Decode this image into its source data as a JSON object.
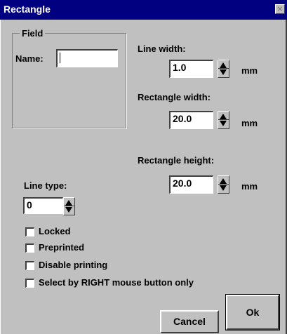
{
  "window": {
    "title": "Rectangle",
    "close_glyph": "×"
  },
  "field_group": {
    "legend": "Field",
    "name_label": "Name:",
    "name_value": ""
  },
  "line_width": {
    "label": "Line width:",
    "value": "1.0",
    "unit": "mm"
  },
  "rect_width": {
    "label": "Rectangle width:",
    "value": "20.0",
    "unit": "mm"
  },
  "rect_height": {
    "label": "Rectangle height:",
    "value": "20.0",
    "unit": "mm"
  },
  "line_type": {
    "label": "Line type:",
    "value": "0"
  },
  "options": [
    {
      "label": "Locked",
      "checked": false
    },
    {
      "label": "Preprinted",
      "checked": false
    },
    {
      "label": "Disable printing",
      "checked": false
    },
    {
      "label": "Select by RIGHT mouse button only",
      "checked": false
    }
  ],
  "buttons": {
    "cancel": "Cancel",
    "ok": "Ok"
  },
  "colors": {
    "title_bar": "#000080",
    "dialog_bg": "#c0c0c0",
    "field_bg": "#ffffff"
  }
}
